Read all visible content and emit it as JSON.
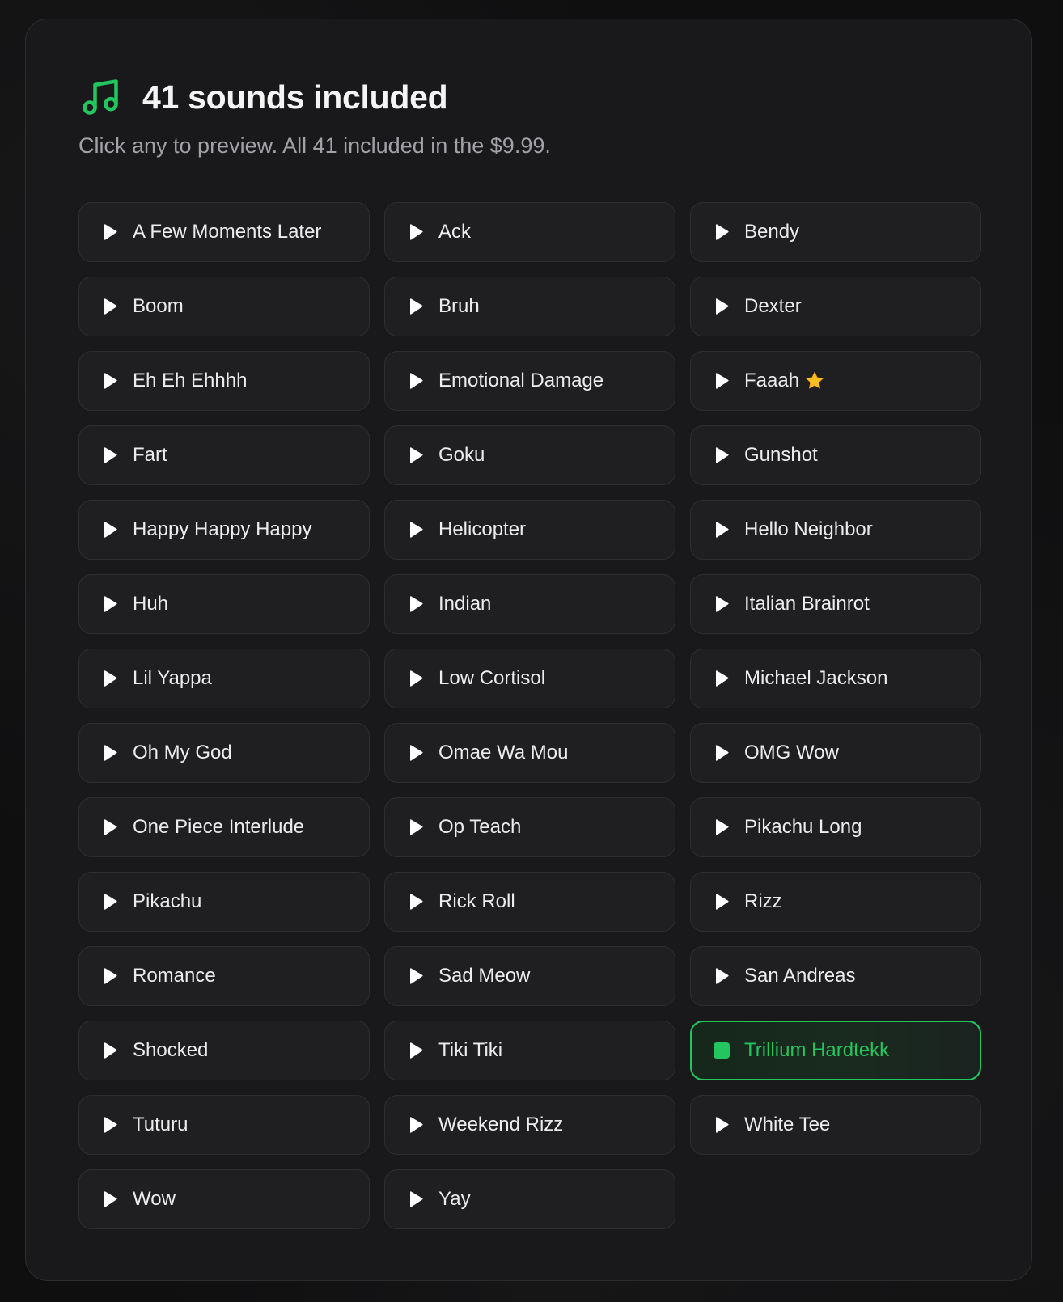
{
  "colors": {
    "accent": "#22c55e",
    "background": "#0f0f10",
    "panel": "#19191b",
    "tile": "#1f1f21",
    "text": "#ececee",
    "muted": "#a1a1a6",
    "star": "#fbbf24"
  },
  "header": {
    "icon": "music-note-icon",
    "title": "41 sounds included",
    "subtitle": "Click any to preview. All 41 included in the $9.99."
  },
  "sounds": [
    {
      "label": "A Few Moments Later"
    },
    {
      "label": "Ack"
    },
    {
      "label": "Bendy"
    },
    {
      "label": "Boom"
    },
    {
      "label": "Bruh"
    },
    {
      "label": "Dexter"
    },
    {
      "label": "Eh Eh Ehhhh"
    },
    {
      "label": "Emotional Damage"
    },
    {
      "label": "Faaah",
      "starred": true
    },
    {
      "label": "Fart"
    },
    {
      "label": "Goku"
    },
    {
      "label": "Gunshot"
    },
    {
      "label": "Happy Happy Happy"
    },
    {
      "label": "Helicopter"
    },
    {
      "label": "Hello Neighbor"
    },
    {
      "label": "Huh"
    },
    {
      "label": "Indian"
    },
    {
      "label": "Italian Brainrot"
    },
    {
      "label": "Lil Yappa"
    },
    {
      "label": "Low Cortisol"
    },
    {
      "label": "Michael Jackson"
    },
    {
      "label": "Oh My God"
    },
    {
      "label": "Omae Wa Mou"
    },
    {
      "label": "OMG Wow"
    },
    {
      "label": "One Piece Interlude"
    },
    {
      "label": "Op Teach"
    },
    {
      "label": "Pikachu Long"
    },
    {
      "label": "Pikachu"
    },
    {
      "label": "Rick Roll"
    },
    {
      "label": "Rizz"
    },
    {
      "label": "Romance"
    },
    {
      "label": "Sad Meow"
    },
    {
      "label": "San Andreas"
    },
    {
      "label": "Shocked"
    },
    {
      "label": "Tiki Tiki"
    },
    {
      "label": "Trillium Hardtekk",
      "playing": true
    },
    {
      "label": "Tuturu"
    },
    {
      "label": "Weekend Rizz"
    },
    {
      "label": "White Tee"
    },
    {
      "label": "Wow"
    },
    {
      "label": "Yay"
    }
  ]
}
